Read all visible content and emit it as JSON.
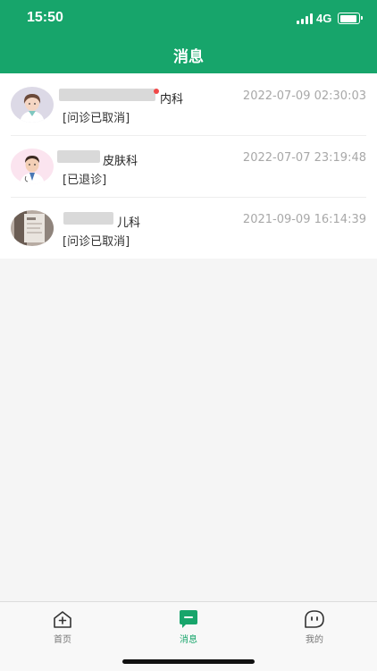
{
  "status_bar": {
    "time": "15:50",
    "network": "4G"
  },
  "header": {
    "title": "消息"
  },
  "messages": [
    {
      "department": "内科",
      "timestamp": "2022-07-09 02:30:03",
      "status": "[问诊已取消]",
      "unread": true
    },
    {
      "department": "皮肤科",
      "timestamp": "2022-07-07 23:19:48",
      "status": "[已退诊]",
      "unread": false
    },
    {
      "department": "儿科",
      "timestamp": "2021-09-09 16:14:39",
      "status": "[问诊已取消]",
      "unread": false
    }
  ],
  "nav": {
    "home": "首页",
    "messages": "消息",
    "mine": "我的"
  },
  "colors": {
    "brand": "#17a56b",
    "unread": "#f04848"
  }
}
